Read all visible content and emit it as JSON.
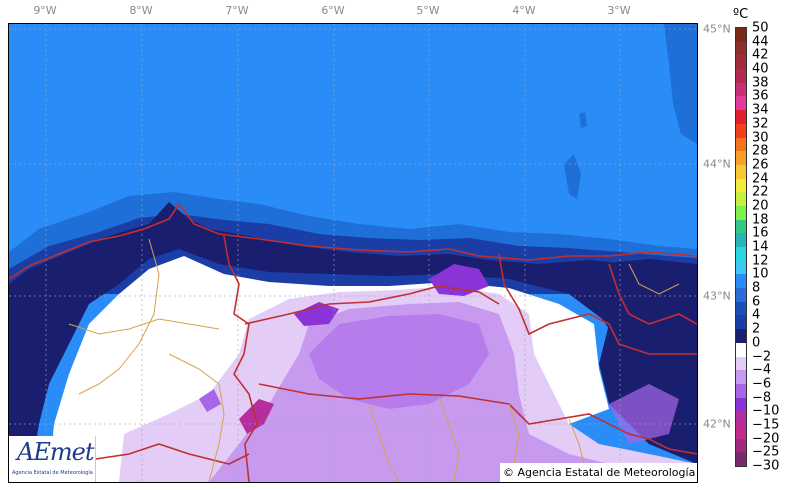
{
  "map": {
    "lon_labels": [
      "9°W",
      "8°W",
      "7°W",
      "6°W",
      "5°W",
      "4°W",
      "3°W"
    ],
    "lat_labels": [
      "45°N",
      "44°N",
      "43°N",
      "42°N"
    ],
    "extent": {
      "lon_min": -9.33,
      "lon_max": -2.55,
      "lat_min": 41.72,
      "lat_max": 45.06
    },
    "gridlines": true,
    "region": "northern Spain — Galicia, Asturias, Cantabria, Basque Country, Castilla y León",
    "field": "temperature",
    "colors": {
      "sea": "#2a8cf7",
      "sea_shallow": "#1f6fd8",
      "sea_coastal": "#1b3da6",
      "band_0_2": "#1a1e6e",
      "land_white": "#ffffff",
      "band_m2": "#e3ccf5",
      "band_m4": "#c79af0",
      "band_m6": "#a865e8",
      "band_m8": "#8a34d8",
      "band_m10": "#b62e9e",
      "border_major": "#c03030",
      "border_minor": "#d4a24a"
    }
  },
  "colorbar": {
    "unit": "ºC",
    "labels": [
      "50",
      "44",
      "42",
      "40",
      "38",
      "36",
      "34",
      "32",
      "30",
      "28",
      "26",
      "24",
      "22",
      "20",
      "18",
      "16",
      "14",
      "12",
      "10",
      "8",
      "6",
      "4",
      "2",
      "0",
      "−2",
      "−4",
      "−6",
      "−8",
      "−10",
      "−15",
      "−20",
      "−25",
      "−30"
    ],
    "colors": [
      "#7a2a1a",
      "#8e2e2e",
      "#a02c3c",
      "#b22a52",
      "#c92f78",
      "#e43a9c",
      "#e0202a",
      "#f0401c",
      "#f4741c",
      "#f6a02a",
      "#f8c832",
      "#f4ec3a",
      "#c8f040",
      "#7ef04c",
      "#34c888",
      "#28b4b4",
      "#28d8e0",
      "#3cc8f0",
      "#2a8cf7",
      "#2a6cd8",
      "#1b4fb8",
      "#1b3da6",
      "#1a1e6e",
      "#ffffff",
      "#e3ccf5",
      "#c79af0",
      "#a865e8",
      "#8a34d8",
      "#b62e9e",
      "#c42a8c",
      "#a02a80",
      "#7a2a6a"
    ]
  },
  "logo": {
    "name": "AEmet",
    "subtitle": "Agencia Estatal de Meteorología"
  },
  "copyright": "© Agencia Estatal de Meteorología"
}
